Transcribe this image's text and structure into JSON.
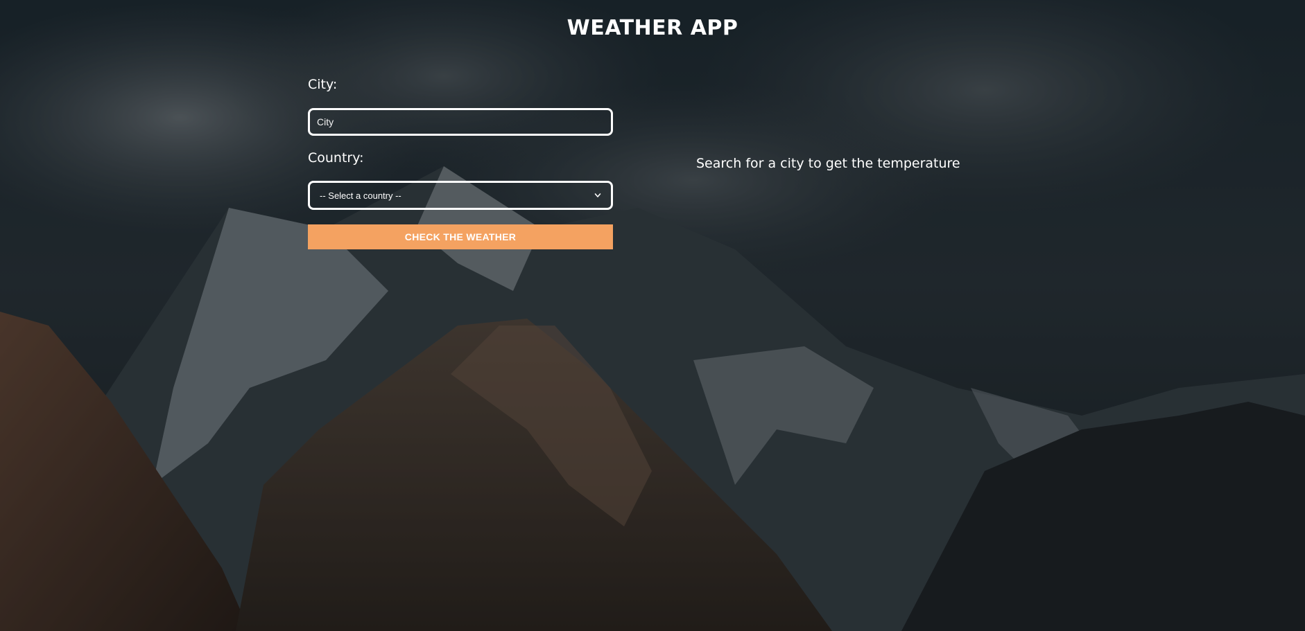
{
  "app": {
    "title": "WEATHER APP"
  },
  "form": {
    "city_label": "City:",
    "city_placeholder": "City",
    "city_value": "",
    "country_label": "Country:",
    "country_selected": "-- Select a country --",
    "submit_label": "CHECK THE WEATHER"
  },
  "result": {
    "message": "Search for a city to get the temperature"
  },
  "icons": {
    "select_chevron": "chevron-down-icon"
  },
  "colors": {
    "accent": "#f4a261",
    "text": "#ffffff",
    "field_border": "#ffffff"
  }
}
